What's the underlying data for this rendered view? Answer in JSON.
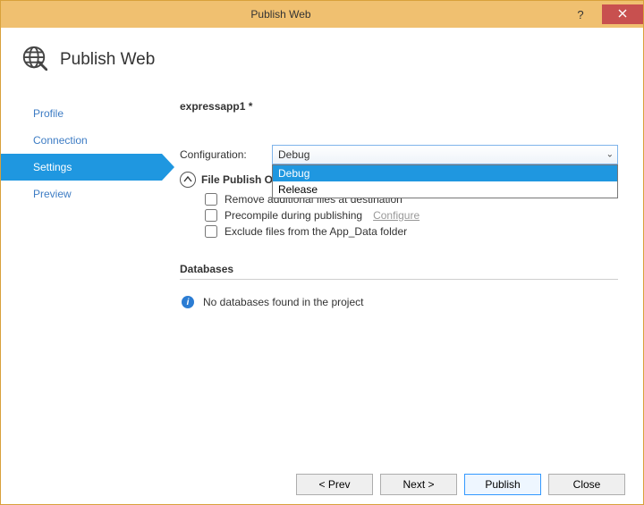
{
  "window": {
    "title": "Publish Web"
  },
  "header": {
    "caption": "Publish Web"
  },
  "sidebar": {
    "items": [
      {
        "label": "Profile",
        "selected": false
      },
      {
        "label": "Connection",
        "selected": false
      },
      {
        "label": "Settings",
        "selected": true
      },
      {
        "label": "Preview",
        "selected": false
      }
    ]
  },
  "main": {
    "project": "expressapp1 *",
    "config_label": "Configuration:",
    "config_value": "Debug",
    "config_options": [
      "Debug",
      "Release"
    ],
    "config_highlighted_index": 0,
    "file_publish_header": "File Publish Options",
    "checks": {
      "remove": {
        "label": "Remove additional files at destination",
        "checked": false
      },
      "precompile": {
        "label": "Precompile during publishing",
        "checked": false,
        "configure": "Configure"
      },
      "exclude": {
        "label": "Exclude files from the App_Data folder",
        "checked": false
      }
    },
    "db_header": "Databases",
    "db_none": "No databases found in the project"
  },
  "footer": {
    "prev": "< Prev",
    "next": "Next >",
    "publish": "Publish",
    "close": "Close"
  }
}
